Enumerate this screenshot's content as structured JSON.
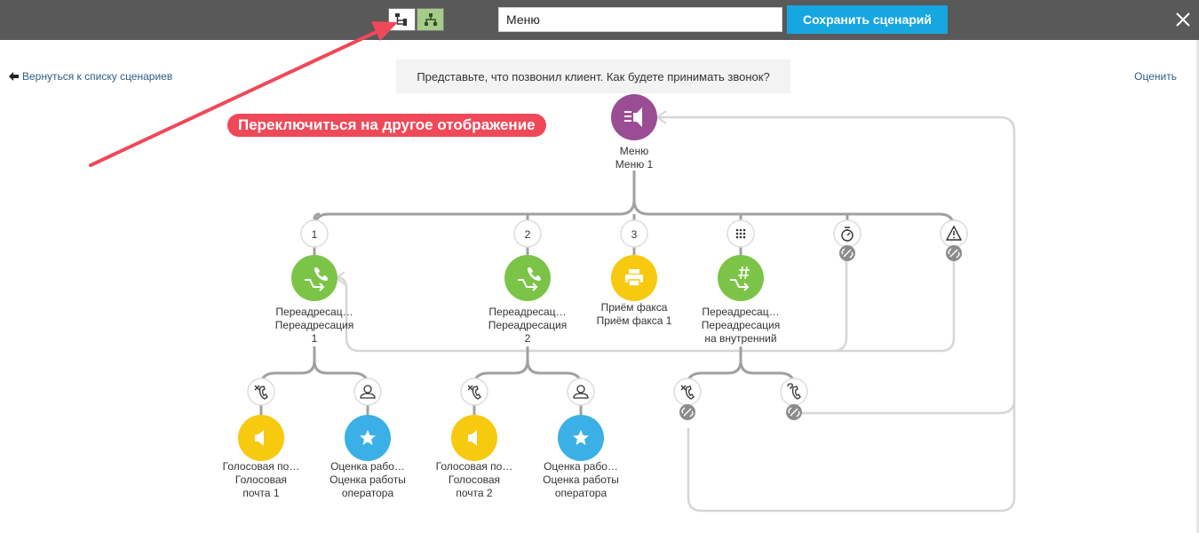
{
  "toolbar": {
    "scenario_name": "Меню",
    "save_label": "Сохранить сценарий",
    "active_view": "tree",
    "graph_view_color": "#a5cb8a"
  },
  "back_link": "Вернуться к списку сценариев",
  "rate_link": "Оценить",
  "hint": "Представьте, что позвонил клиент. Как будете принимать звонок?",
  "callout": "Переключиться на другое отображение",
  "colors": {
    "menu": "#9b4d94",
    "redirect": "#7cc447",
    "fax": "#f7c90f",
    "voicemail": "#f7c90f",
    "rating": "#3bb0e6",
    "callout": "#ef4959",
    "save": "#16a6e0",
    "connector": "#a0a0a0",
    "loop": "#d6d6d6"
  },
  "root": {
    "icon": "menu-speaker-icon",
    "line1": "Меню",
    "line2": "Меню 1"
  },
  "branches": {
    "b1": {
      "key": "1",
      "line1": "Переадресац…",
      "line2": "Переадресация",
      "line3": "1"
    },
    "b2": {
      "key": "2",
      "line1": "Переадресац…",
      "line2": "Переадресация",
      "line3": "2"
    },
    "b3": {
      "key": "3",
      "line1": "Приём факса",
      "line2": "Приём факса 1"
    },
    "b4": {
      "key_icon": "keypad-icon",
      "line1": "Переадресац…",
      "line2": "Переадресация",
      "line3": "на внутренний"
    },
    "b5": {
      "key_icon": "timer-icon"
    },
    "b6": {
      "key_icon": "warning-icon"
    }
  },
  "leaves": {
    "l1": {
      "line1": "Голосовая по…",
      "line2": "Голосовая",
      "line3": "почта 1"
    },
    "l2": {
      "line1": "Оценка рабо…",
      "line2": "Оценка работы",
      "line3": "оператора"
    },
    "l3": {
      "line1": "Голосовая по…",
      "line2": "Голосовая",
      "line3": "почта 2"
    },
    "l4": {
      "line1": "Оценка рабо…",
      "line2": "Оценка работы",
      "line3": "оператора"
    }
  }
}
